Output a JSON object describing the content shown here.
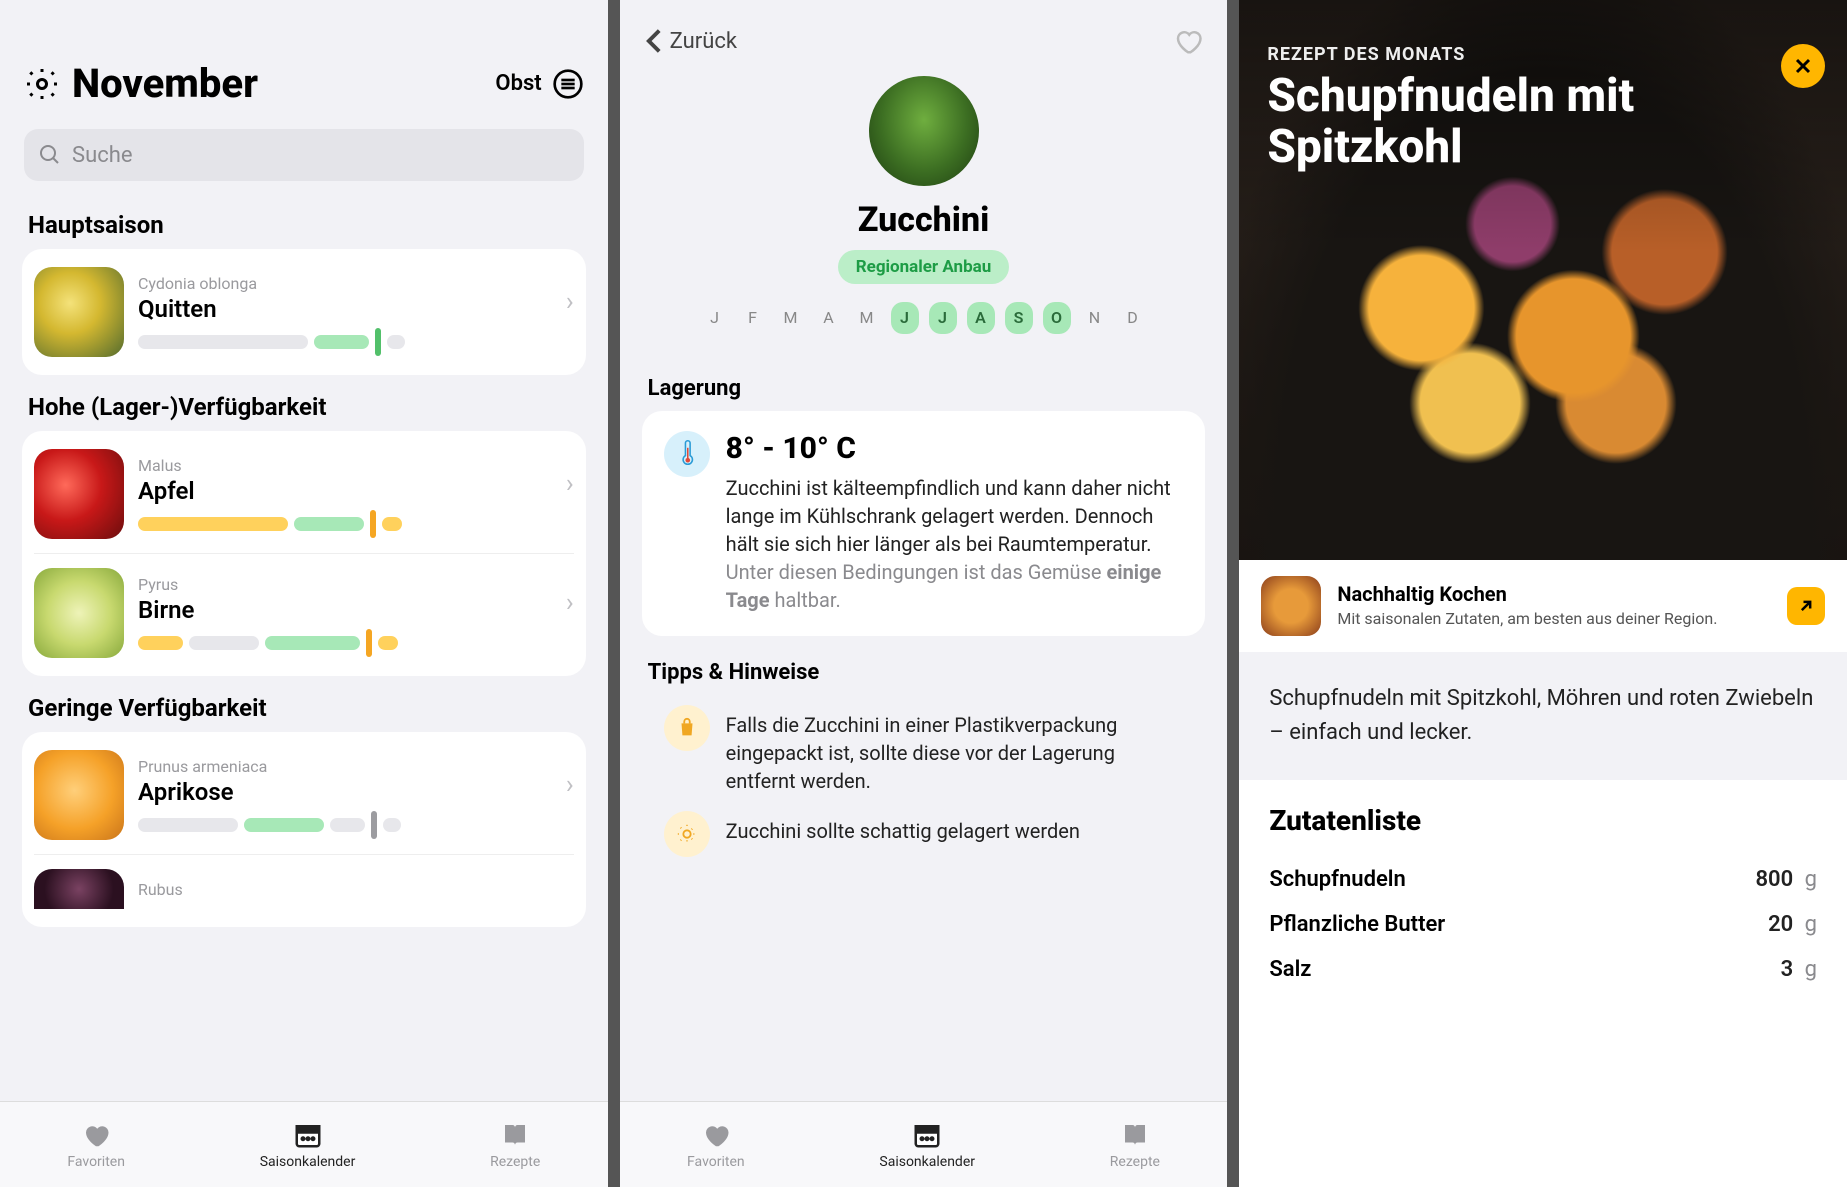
{
  "screen1": {
    "month": "November",
    "filter_label": "Obst",
    "search_placeholder": "Suche",
    "sections": [
      {
        "title": "Hauptsaison",
        "items": [
          {
            "latin": "Cydonia oblonga",
            "name": "Quitten"
          }
        ]
      },
      {
        "title": "Hohe (Lager-)Verfügbarkeit",
        "items": [
          {
            "latin": "Malus",
            "name": "Apfel"
          },
          {
            "latin": "Pyrus",
            "name": "Birne"
          }
        ]
      },
      {
        "title": "Geringe Verfügbarkeit",
        "items": [
          {
            "latin": "Prunus armeniaca",
            "name": "Aprikose"
          },
          {
            "latin": "Rubus",
            "name": ""
          }
        ]
      }
    ],
    "tabs": {
      "fav": "Favoriten",
      "cal": "Saisonkalender",
      "rec": "Rezepte",
      "active": "cal"
    }
  },
  "screen2": {
    "back": "Zurück",
    "name": "Zucchini",
    "badge": "Regionaler Anbau",
    "months": [
      "J",
      "F",
      "M",
      "A",
      "M",
      "J",
      "J",
      "A",
      "S",
      "O",
      "N",
      "D"
    ],
    "months_on": [
      5,
      6,
      7,
      8,
      9
    ],
    "storage_title": "Lagerung",
    "temperature": "8° - 10° C",
    "storage_text_main": "Zucchini ist kälteempfindlich und kann daher nicht lange im Kühlschrank gelagert werden. Dennoch hält sie sich hier länger als bei Raumtemperatur.",
    "storage_text_gray_pre": "Unter diesen Bedingungen ist das Gemüse ",
    "storage_text_bold": "einige Tage",
    "storage_text_gray_post": " haltbar.",
    "tips_title": "Tipps & Hinweise",
    "tip1": "Falls die Zucchini in einer Plastikverpackung eingepackt ist, sollte diese vor der Lagerung entfernt werden.",
    "tip2": "Zucchini sollte schattig gelagert werden",
    "tabs": {
      "fav": "Favoriten",
      "cal": "Saisonkalender",
      "rec": "Rezepte",
      "active": "cal"
    }
  },
  "screen3": {
    "eyebrow": "REZEPT DES MONATS",
    "title": "Schupfnudeln mit Spitzkohl",
    "promo_title": "Nachhaltig Kochen",
    "promo_sub": "Mit saisonalen Zutaten, am besten aus deiner Region.",
    "description": "Schupfnudeln mit Spitzkohl, Möhren und roten Zwiebeln – einfach und lecker.",
    "ingredients_title": "Zutatenliste",
    "ingredients": [
      {
        "name": "Schupfnudeln",
        "amount": "800",
        "unit": "g"
      },
      {
        "name": "Pflanzliche Butter",
        "amount": "20",
        "unit": "g"
      },
      {
        "name": "Salz",
        "amount": "3",
        "unit": "g"
      }
    ]
  }
}
